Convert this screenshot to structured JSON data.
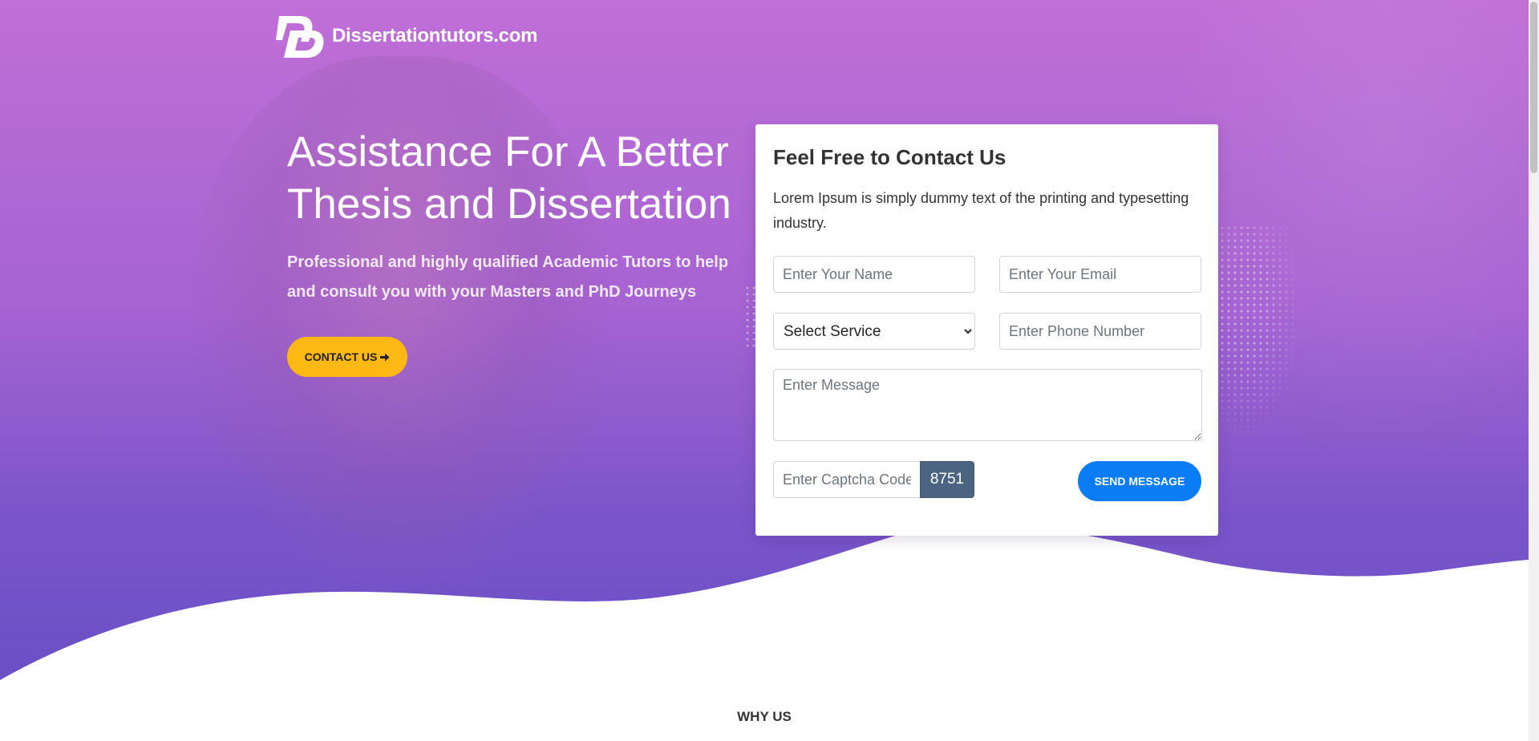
{
  "brand": {
    "name": "Dissertationtutors.com",
    "logo_icon": "dt-logo-icon"
  },
  "hero": {
    "headline": "Assistance For A Better Thesis and Dissertation",
    "subtext": "Professional and highly qualified Academic Tutors to help and consult you with your Masters and PhD Journeys",
    "cta_label": "CONTACT US",
    "cta_icon": "arrow-right-icon"
  },
  "contact_form": {
    "title": "Feel Free to Contact Us",
    "description": "Lorem Ipsum is simply dummy text of the printing and typesetting industry.",
    "name_placeholder": "Enter Your Name",
    "email_placeholder": "Enter Your Email",
    "service_selected": "Select Service",
    "phone_placeholder": "Enter Phone Number",
    "message_placeholder": "Enter Message",
    "captcha_placeholder": "Enter Captcha Code",
    "captcha_code": "8751",
    "submit_label": "SEND MESSAGE"
  },
  "section": {
    "why_us_label": "WHY US"
  },
  "colors": {
    "hero_gradient_top": "#c06fd6",
    "hero_gradient_bottom": "#6a4fc6",
    "cta_yellow": "#fdb813",
    "send_blue": "#0a7df5",
    "captcha_bg": "#4a6482"
  }
}
